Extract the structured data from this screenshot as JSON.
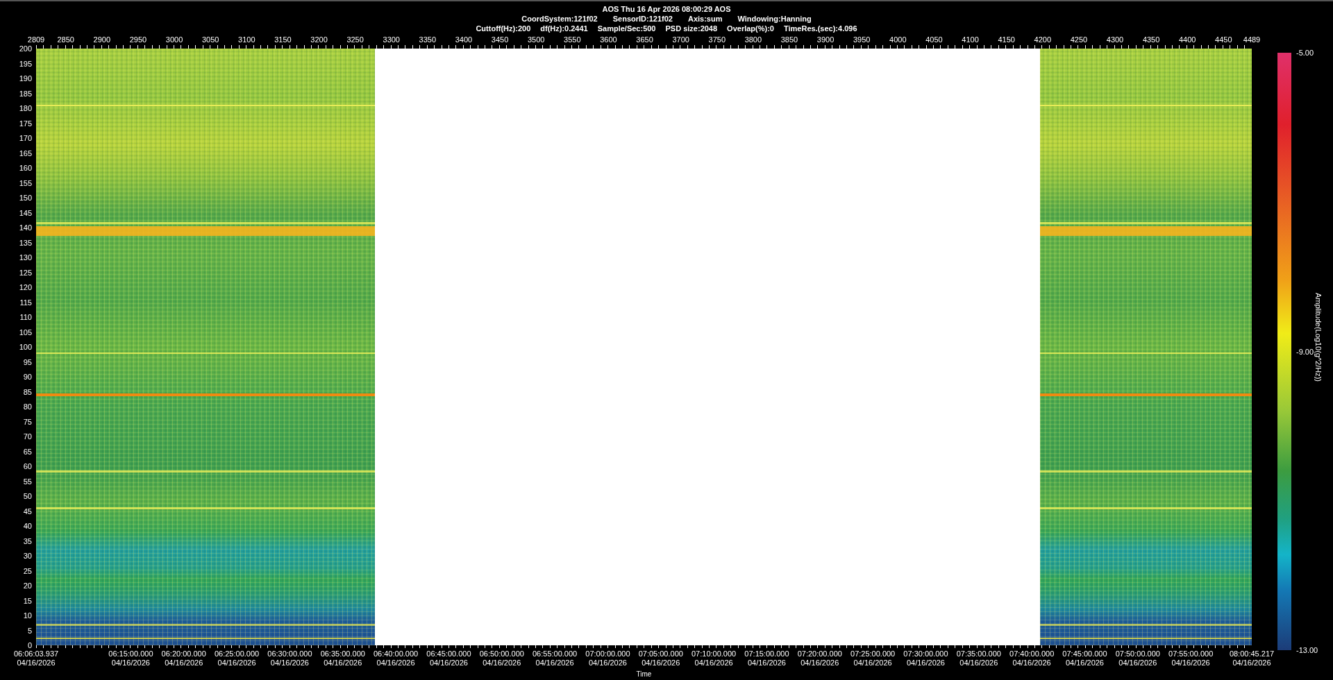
{
  "header": {
    "title": "AOS  Thu 16 Apr 2026 08:00:29  AOS",
    "line_2": [
      "CoordSystem:121f02",
      "SensorID:121f02",
      "Axis:sum",
      "Windowing:Hanning"
    ],
    "line_3": [
      "Cuttoff(Hz):200",
      "df(Hz):0.2441",
      "Sample/Sec:500",
      "PSD size:2048",
      "Overlap(%):0",
      "TimeRes.(sec):4.096"
    ]
  },
  "top_axis": {
    "labels": [
      "2809",
      "2850",
      "2900",
      "2950",
      "3000",
      "3050",
      "3100",
      "3150",
      "3200",
      "3250",
      "3300",
      "3350",
      "3400",
      "3450",
      "3500",
      "3550",
      "3600",
      "3650",
      "3700",
      "3750",
      "3800",
      "3850",
      "3900",
      "3950",
      "4000",
      "4050",
      "4100",
      "4150",
      "4200",
      "4250",
      "4300",
      "4350",
      "4400",
      "4450",
      "4489"
    ]
  },
  "y_axis": {
    "labels": [
      "200",
      "195",
      "190",
      "185",
      "180",
      "175",
      "170",
      "165",
      "160",
      "155",
      "150",
      "145",
      "140",
      "135",
      "130",
      "125",
      "120",
      "115",
      "110",
      "105",
      "100",
      "95",
      "90",
      "85",
      "80",
      "75",
      "70",
      "65",
      "60",
      "55",
      "50",
      "45",
      "40",
      "35",
      "30",
      "25",
      "20",
      "15",
      "10",
      "5",
      "0"
    ]
  },
  "x_axis": {
    "title": "Time",
    "labels": [
      {
        "time": "06:06:03.937",
        "date": "04/16/2026"
      },
      {
        "time": "06:15:00.000",
        "date": "04/16/2026"
      },
      {
        "time": "06:20:00.000",
        "date": "04/16/2026"
      },
      {
        "time": "06:25:00.000",
        "date": "04/16/2026"
      },
      {
        "time": "06:30:00.000",
        "date": "04/16/2026"
      },
      {
        "time": "06:35:00.000",
        "date": "04/16/2026"
      },
      {
        "time": "06:40:00.000",
        "date": "04/16/2026"
      },
      {
        "time": "06:45:00.000",
        "date": "04/16/2026"
      },
      {
        "time": "06:50:00.000",
        "date": "04/16/2026"
      },
      {
        "time": "06:55:00.000",
        "date": "04/16/2026"
      },
      {
        "time": "07:00:00.000",
        "date": "04/16/2026"
      },
      {
        "time": "07:05:00.000",
        "date": "04/16/2026"
      },
      {
        "time": "07:10:00.000",
        "date": "04/16/2026"
      },
      {
        "time": "07:15:00.000",
        "date": "04/16/2026"
      },
      {
        "time": "07:20:00.000",
        "date": "04/16/2026"
      },
      {
        "time": "07:25:00.000",
        "date": "04/16/2026"
      },
      {
        "time": "07:30:00.000",
        "date": "04/16/2026"
      },
      {
        "time": "07:35:00.000",
        "date": "04/16/2026"
      },
      {
        "time": "07:40:00.000",
        "date": "04/16/2026"
      },
      {
        "time": "07:45:00.000",
        "date": "04/16/2026"
      },
      {
        "time": "07:50:00.000",
        "date": "04/16/2026"
      },
      {
        "time": "07:55:00.000",
        "date": "04/16/2026"
      },
      {
        "time": "08:00:45.217",
        "date": "04/16/2026"
      }
    ]
  },
  "colorbar": {
    "title": "Amplitude(Log10(g^2/Hz))",
    "labels": [
      "-5.00",
      "-9.00",
      "-13.00"
    ]
  }
}
